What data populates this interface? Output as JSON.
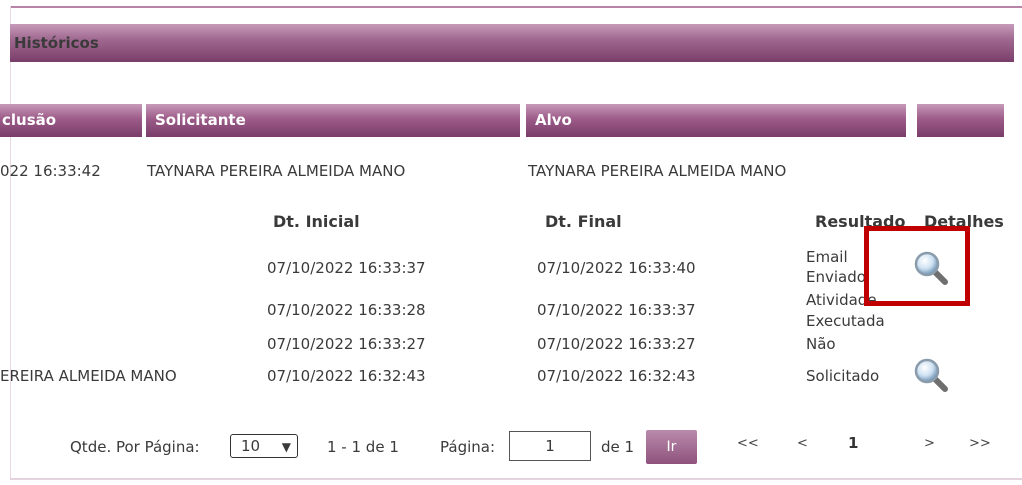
{
  "section": {
    "title": "Históricos"
  },
  "columns": {
    "inclusao": "clusão",
    "solicitante": "Solicitante",
    "alvo": "Alvo",
    "extra": ""
  },
  "row": {
    "inclusao": "022 16:33:42",
    "solicitante": "TAYNARA PEREIRA ALMEIDA MANO",
    "alvo": "TAYNARA PEREIRA ALMEIDA MANO"
  },
  "sub_headers": {
    "dt_inicial": "Dt. Inicial",
    "dt_final": "Dt. Final",
    "resultado": "Resultado",
    "detalhes": "Detalhes"
  },
  "details": [
    {
      "name": "",
      "dt_inicial": "07/10/2022 16:33:37",
      "dt_final": "07/10/2022 16:33:40",
      "resultado_line1": "Email",
      "resultado_line2": "Enviado",
      "has_detail": true
    },
    {
      "name": "",
      "dt_inicial": "07/10/2022 16:33:28",
      "dt_final": "07/10/2022 16:33:37",
      "resultado_line1": "Atividade",
      "resultado_line2": "Executada",
      "has_detail": false
    },
    {
      "name": "",
      "dt_inicial": "07/10/2022 16:33:27",
      "dt_final": "07/10/2022 16:33:27",
      "resultado_line1": "Não",
      "resultado_line2": "",
      "has_detail": false
    },
    {
      "name": "EREIRA ALMEIDA MANO",
      "dt_inicial": "07/10/2022 16:32:43",
      "dt_final": "07/10/2022 16:32:43",
      "resultado_line1": "Solicitado",
      "resultado_line2": "",
      "has_detail": true
    }
  ],
  "pager": {
    "per_page_label": "Qtde. Por Página:",
    "per_page_value": "10",
    "range": "1 - 1 de 1",
    "page_label": "Página:",
    "page_value": "1",
    "of_total": "de 1",
    "go": "Ir",
    "first": "<<",
    "prev": "<",
    "current": "1",
    "next": ">",
    "last": ">>"
  },
  "colors": {
    "header_purple": "#8f527d",
    "highlight": "#c00000"
  },
  "icons": {
    "detail": "magnifier-icon",
    "select": "chevron-down-icon"
  }
}
